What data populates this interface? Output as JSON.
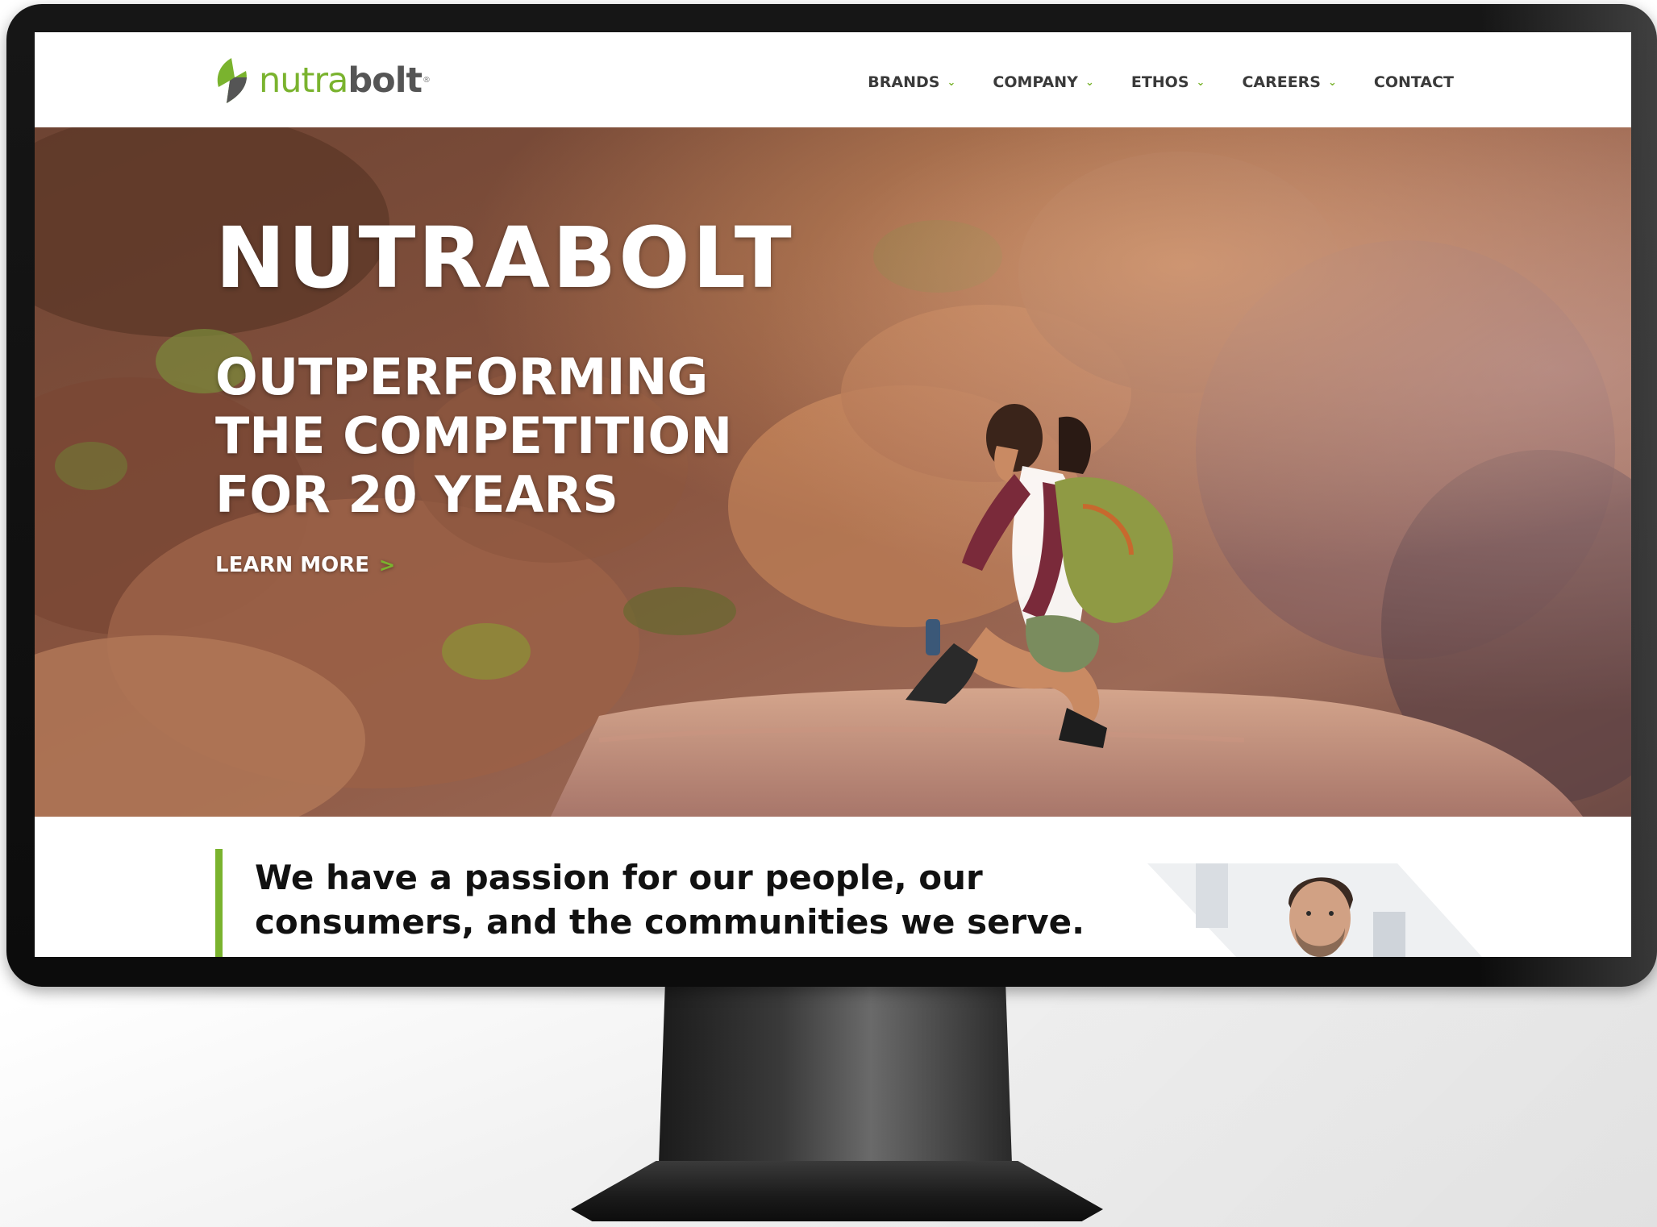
{
  "colors": {
    "accent_green": "#7ab32e",
    "nav_text": "#3a3a3a",
    "hero_text": "#ffffff",
    "intro_text": "#111111"
  },
  "brand": {
    "name_part1": "nutra",
    "name_part2": "bolt",
    "trademark": "®",
    "logo_icon": "bolt-leaf-icon"
  },
  "nav": {
    "items": [
      {
        "label": "BRANDS",
        "has_dropdown": true
      },
      {
        "label": "COMPANY",
        "has_dropdown": true
      },
      {
        "label": "ETHOS",
        "has_dropdown": true
      },
      {
        "label": "CAREERS",
        "has_dropdown": true
      },
      {
        "label": "CONTACT",
        "has_dropdown": false
      }
    ],
    "dropdown_icon": "chevron-down-icon",
    "dropdown_glyph": "⌄"
  },
  "hero": {
    "title": "NUTRABOLT",
    "subtitle_lines": [
      "OUTPERFORMING",
      "THE COMPETITION",
      "FOR 20 YEARS"
    ],
    "cta_label": "LEARN MORE",
    "cta_arrow": ">",
    "image": "hiker-on-red-rock-canyon-photo"
  },
  "intro": {
    "quote_lines": [
      "We have a passion for our people, our",
      "consumers, and the communities we serve."
    ],
    "person_image": "man-portrait-photo"
  }
}
